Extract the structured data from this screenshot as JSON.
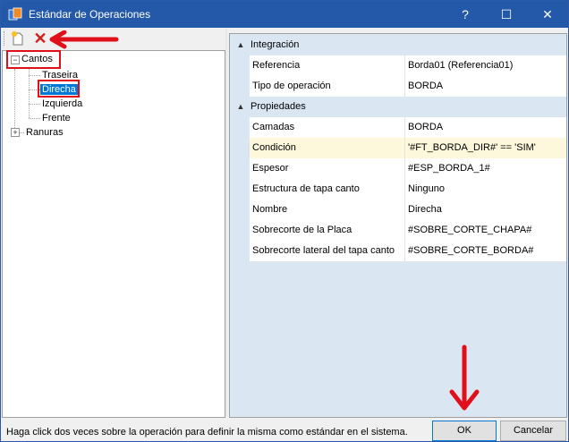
{
  "window": {
    "title": "Estándar de Operaciones",
    "controls": {
      "help": "?",
      "maximize": "☐",
      "close": "✕"
    }
  },
  "toolbar": {
    "new_icon": "new-document-icon",
    "delete_icon": "delete-x-icon"
  },
  "tree": {
    "root": {
      "label": "Cantos",
      "expanded": true,
      "children": [
        "Traseira",
        "Direcha",
        "Izquierda",
        "Frente"
      ]
    },
    "second": {
      "label": "Ranuras",
      "expanded": false
    },
    "selected": "Direcha"
  },
  "properties": {
    "categories": [
      {
        "label": "Integración",
        "rows": [
          {
            "name": "Referencia",
            "value": "Borda01 (Referencia01)"
          },
          {
            "name": "Tipo de operación",
            "value": "BORDA"
          }
        ]
      },
      {
        "label": "Propiedades",
        "rows": [
          {
            "name": "Camadas",
            "value": "BORDA"
          },
          {
            "name": "Condición",
            "value": "'#FT_BORDA_DIR#' == 'SIM'"
          },
          {
            "name": "Espesor",
            "value": "#ESP_BORDA_1#"
          },
          {
            "name": "Estructura de tapa canto",
            "value": "Ninguno"
          },
          {
            "name": "Nombre",
            "value": "Direcha"
          },
          {
            "name": "Sobrecorte de la Placa",
            "value": "#SOBRE_CORTE_CHAPA#"
          },
          {
            "name": "Sobrecorte lateral del tapa canto",
            "value": "#SOBRE_CORTE_BORDA#"
          }
        ]
      }
    ]
  },
  "footer": {
    "status": "Haga click dos veces sobre la operación para definir la misma como estándar en el sistema.",
    "ok": "OK",
    "cancel": "Cancelar"
  },
  "annotation_colors": {
    "callout": "#e0101a"
  }
}
